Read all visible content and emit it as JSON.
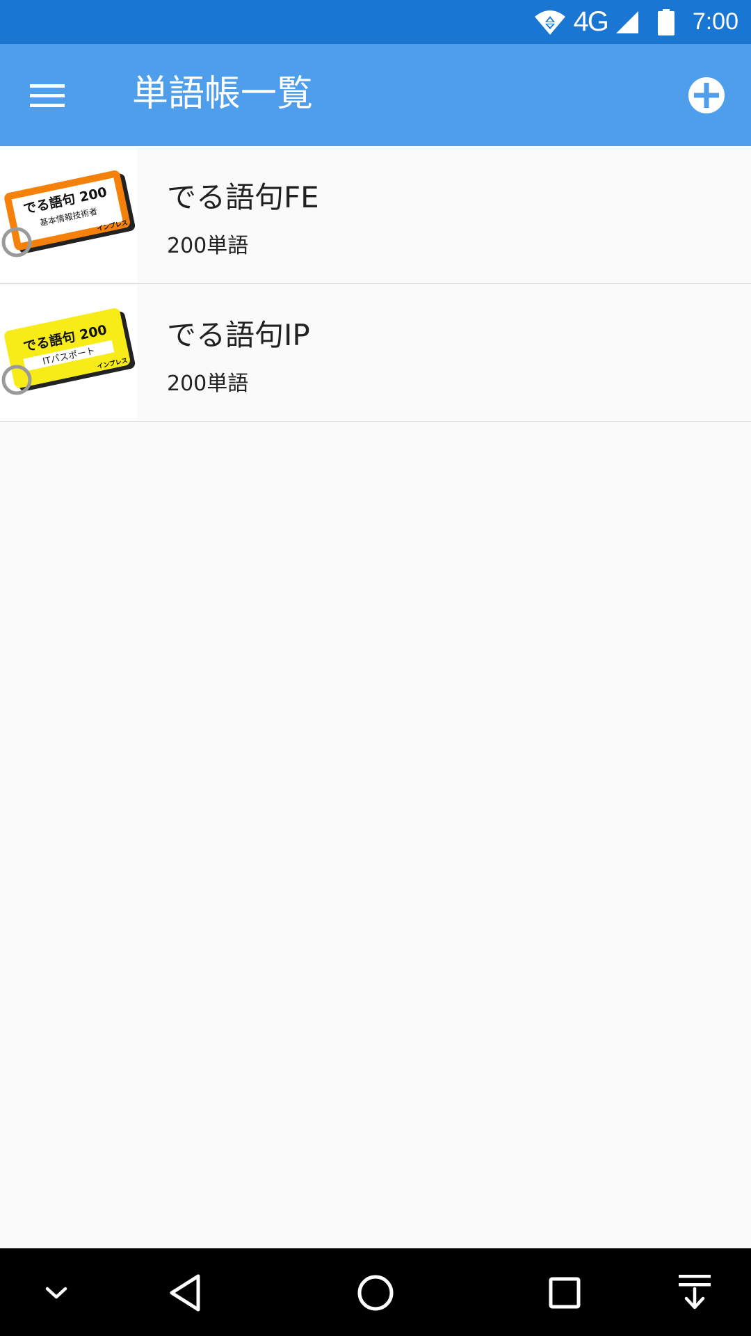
{
  "status_bar": {
    "network": "4G",
    "time": "7:00",
    "icons": [
      "wifi-icon",
      "cell-signal-icon",
      "battery-icon"
    ]
  },
  "app_bar": {
    "title": "単語帳一覧",
    "menu_icon": "hamburger-menu-icon",
    "add_icon": "add-circle-icon",
    "background": "#4f9eec"
  },
  "wordbooks": [
    {
      "title": "でる語句FE",
      "count": "200単語",
      "thumb": {
        "line1": "でる語句 200",
        "line2": "基本情報技術者",
        "publisher": "インプレス",
        "color": "#f5800a"
      }
    },
    {
      "title": "でる語句IP",
      "count": "200単語",
      "thumb": {
        "line1": "でる語句 200",
        "line2": "ITパスポート",
        "publisher": "インプレス",
        "color": "#f7ec18"
      }
    }
  ],
  "nav_bar": {
    "icons": [
      "chevron-down-icon",
      "back-icon",
      "home-icon",
      "recents-icon",
      "notification-pull-icon"
    ]
  }
}
